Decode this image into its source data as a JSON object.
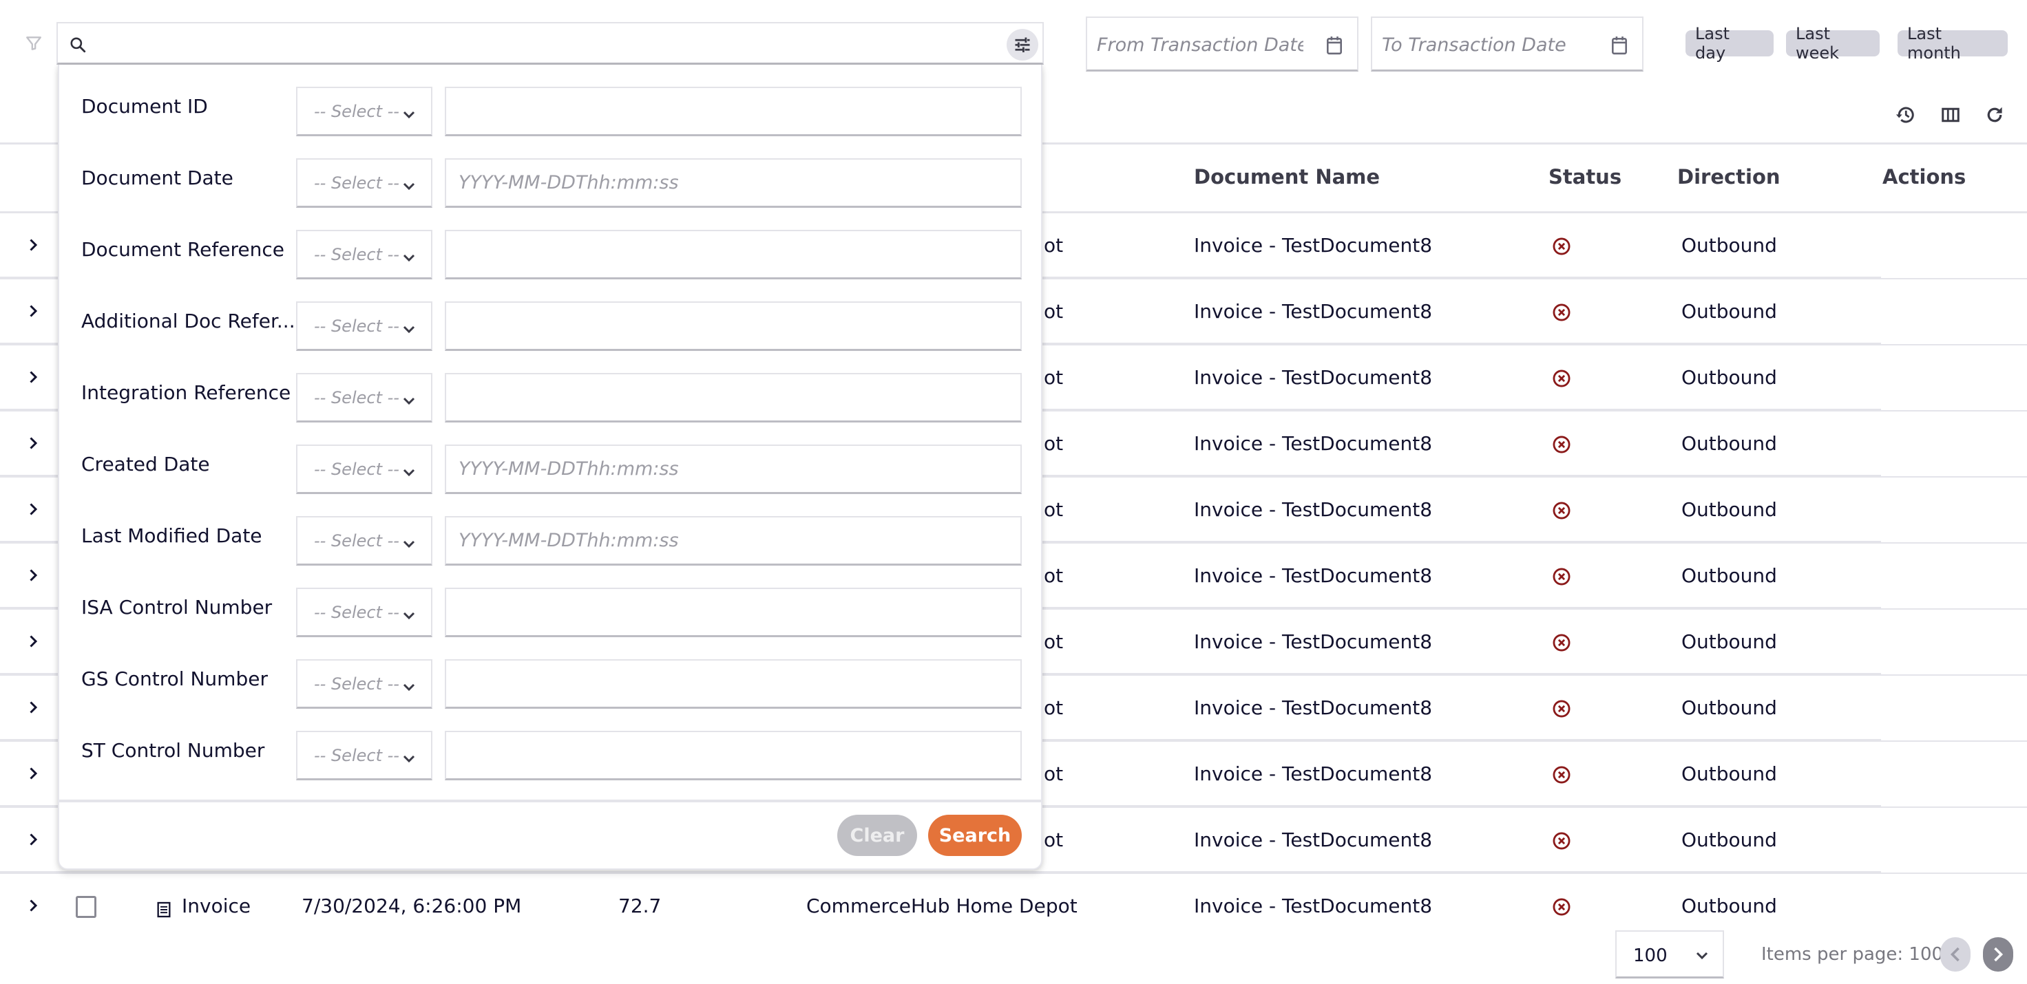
{
  "toolbar": {
    "search_placeholder": "",
    "search_value": "",
    "from_date_placeholder": "From Transaction Date",
    "to_date_placeholder": "To Transaction Date",
    "quick_ranges": [
      "Last day",
      "Last week",
      "Last month"
    ]
  },
  "icons": {
    "filter": "filter-icon",
    "search": "search-icon",
    "advanced_search_toggle": "tune-icon",
    "calendar": "calendar-icon",
    "history": "history-icon",
    "columns": "columns-icon",
    "refresh": "refresh-icon",
    "expand": "chevron-right-icon",
    "status_error": "error-circle-icon",
    "document": "document-icon"
  },
  "colors": {
    "accent": "#e4733a",
    "status_error": "#8b1a1a",
    "clear_button": "#c0c0c5",
    "quick_range_bg": "#d5d5de"
  },
  "table": {
    "columns": {
      "document_name": "Document Name",
      "status": "Status",
      "direction": "Direction",
      "actions": "Actions"
    },
    "rows": [
      {
        "partner_tail": "ot",
        "document_name": "Invoice - TestDocument8",
        "status": "error",
        "direction": "Outbound"
      },
      {
        "partner_tail": "ot",
        "document_name": "Invoice - TestDocument8",
        "status": "error",
        "direction": "Outbound"
      },
      {
        "partner_tail": "ot",
        "document_name": "Invoice - TestDocument8",
        "status": "error",
        "direction": "Outbound"
      },
      {
        "partner_tail": "ot",
        "document_name": "Invoice - TestDocument8",
        "status": "error",
        "direction": "Outbound"
      },
      {
        "partner_tail": "ot",
        "document_name": "Invoice - TestDocument8",
        "status": "error",
        "direction": "Outbound"
      },
      {
        "partner_tail": "ot",
        "document_name": "Invoice - TestDocument8",
        "status": "error",
        "direction": "Outbound"
      },
      {
        "partner_tail": "ot",
        "document_name": "Invoice - TestDocument8",
        "status": "error",
        "direction": "Outbound"
      },
      {
        "partner_tail": "ot",
        "document_name": "Invoice - TestDocument8",
        "status": "error",
        "direction": "Outbound"
      },
      {
        "partner_tail": "ot",
        "document_name": "Invoice - TestDocument8",
        "status": "error",
        "direction": "Outbound"
      },
      {
        "partner_tail": "ot",
        "document_name": "Invoice - TestDocument8",
        "status": "error",
        "direction": "Outbound"
      }
    ],
    "full_row": {
      "type": "Invoice",
      "date": "7/30/2024, 6:26:00 PM",
      "amount": "72.7",
      "partner": "CommerceHub Home Depot",
      "document_name": "Invoice - TestDocument8",
      "status": "error",
      "direction": "Outbound"
    }
  },
  "pagination": {
    "page_size": "100",
    "items_per_page_label": "Items per page: 100"
  },
  "advanced_search": {
    "operator_placeholder": "-- Select --",
    "fields": [
      {
        "label": "Document ID",
        "placeholder": ""
      },
      {
        "label": "Document Date",
        "placeholder": "YYYY-MM-DDThh:mm:ss"
      },
      {
        "label": "Document Reference",
        "placeholder": ""
      },
      {
        "label": "Additional Doc Refer...",
        "placeholder": ""
      },
      {
        "label": "Integration Reference",
        "placeholder": ""
      },
      {
        "label": "Created Date",
        "placeholder": "YYYY-MM-DDThh:mm:ss"
      },
      {
        "label": "Last Modified Date",
        "placeholder": "YYYY-MM-DDThh:mm:ss"
      },
      {
        "label": "ISA Control Number",
        "placeholder": ""
      },
      {
        "label": "GS Control Number",
        "placeholder": ""
      },
      {
        "label": "ST Control Number",
        "placeholder": ""
      }
    ],
    "clear_label": "Clear",
    "search_label": "Search"
  }
}
